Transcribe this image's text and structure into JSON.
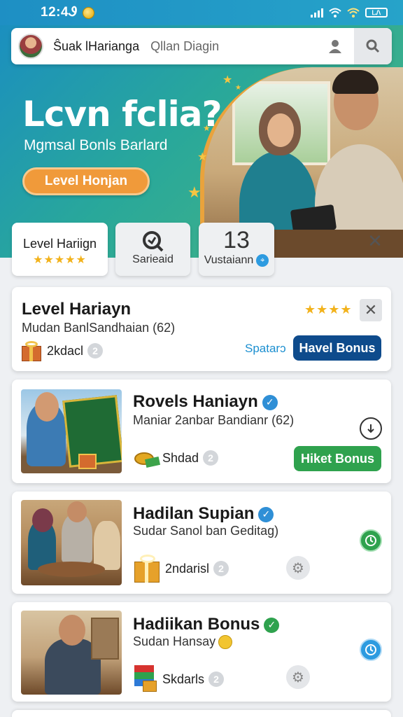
{
  "status": {
    "time": "12:4Ꮽ",
    "battery": "ᏞᏁ"
  },
  "search": {
    "app_name": "Ŝuak lHarianga",
    "placeholder": "Qllan Diagin"
  },
  "hero": {
    "title": "Lcvn fclia?",
    "subtitle": "Mgmsal Bonls Barlard",
    "button": "Level Honjan"
  },
  "tabs": [
    {
      "label": "Level Hariign",
      "stars": "★★★★★"
    },
    {
      "label": "Sarieaid"
    },
    {
      "count": "13",
      "label": "Vustaiann"
    }
  ],
  "cards": [
    {
      "title": "Level Hariayn",
      "stars": "★★★★",
      "subtitle": "Mudan BanlSandhaian (62)",
      "meta": "2kdacl",
      "count": "2",
      "link": "Spatarᴐ",
      "button": "Havel Bonus",
      "button_color": "#0e4b8c"
    },
    {
      "title": "Rovels Haniayn",
      "subtitle": "Maniar 2anbar Bandianr (62)",
      "meta": "Shdad",
      "count": "2",
      "button": "Hiket Bonus",
      "button_color": "#2fa24e"
    },
    {
      "title": "Hadilan Supian",
      "subtitle": "Sudar Sanol ban Geditag)",
      "meta": "2ndarisl",
      "count": "2"
    },
    {
      "title": "Hadiikan Bonus",
      "subtitle": "Sudan Hansay",
      "meta": "Skdarls",
      "count": "2"
    }
  ],
  "colors": {
    "accent_blue": "#0e4b8c",
    "accent_green": "#2fa24e",
    "hero_orange": "#f09a3a",
    "star_gold": "#f2b21b"
  }
}
